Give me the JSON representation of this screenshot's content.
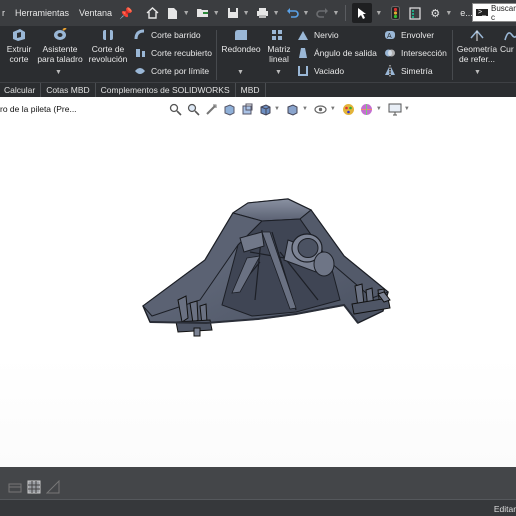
{
  "menu": {
    "items": [
      "r",
      "Herramientas",
      "Ventana"
    ],
    "ellipsis": "e...",
    "search_placeholder": "Buscar c"
  },
  "toolbar_icons": [
    "pin-icon",
    "home-icon",
    "new-document-icon",
    "open-icon",
    "save-icon",
    "print-icon",
    "undo-icon",
    "redo-icon",
    "select-pointer-icon",
    "traffic-light-icon",
    "file-properties-icon",
    "options-gear-icon"
  ],
  "ribbon": {
    "big_buttons": [
      {
        "label": "Extruir\ncorte",
        "icon": "extrude-cut-icon"
      },
      {
        "label": "Asistente\npara taladro",
        "icon": "hole-wizard-icon"
      },
      {
        "label": "Corte de\nrevolución",
        "icon": "revolved-cut-icon"
      },
      {
        "label": "Redondeo",
        "icon": "fillet-icon"
      },
      {
        "label": "Matriz\nlineal",
        "icon": "linear-pattern-icon"
      },
      {
        "label": "Geometría\nde refer...",
        "icon": "reference-geometry-icon"
      },
      {
        "label": "Cur",
        "icon": "curves-icon"
      }
    ],
    "col1": [
      "Corte barrido",
      "Corte recubierto",
      "Corte por límite"
    ],
    "col2": [
      "Nervio",
      "Ángulo de salida",
      "Vaciado"
    ],
    "col3": [
      "Envolver",
      "Intersección",
      "Simetría"
    ]
  },
  "tabs": [
    "Calcular",
    "Cotas MBD",
    "Complementos de SOLIDWORKS",
    "MBD"
  ],
  "viewport": {
    "tree_label": "ro de la pileta (Pre..."
  },
  "status": {
    "mode": "Editan"
  },
  "colors": {
    "menubar": "#3b3d40",
    "ribbon": "#2b2d30",
    "part_face": "#5d6474",
    "part_dark": "#3e4452",
    "part_light": "#7a8192"
  }
}
